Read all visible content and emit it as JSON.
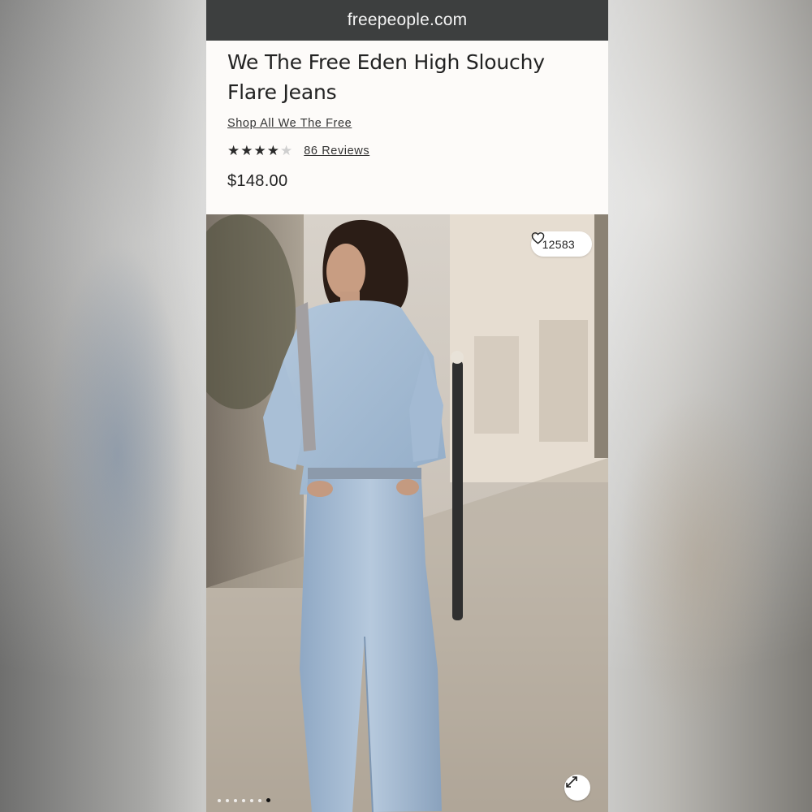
{
  "browser": {
    "url": "freepeople.com"
  },
  "product": {
    "title_line1": "We The Free Eden High Slouchy",
    "title_line2": "Flare Jeans",
    "brand_link": "Shop All We The Free",
    "rating": 4,
    "rating_max": 5,
    "reviews_link": "86 Reviews",
    "price": "$148.00"
  },
  "gallery": {
    "like_count": "12583",
    "slide_count": 7,
    "active_slide": 7,
    "icons": {
      "like": "heart-icon",
      "expand": "expand-icon"
    }
  },
  "colors": {
    "url_bar": "#3d3f3f",
    "page_background": "#fdfbf9",
    "text": "#222222"
  }
}
